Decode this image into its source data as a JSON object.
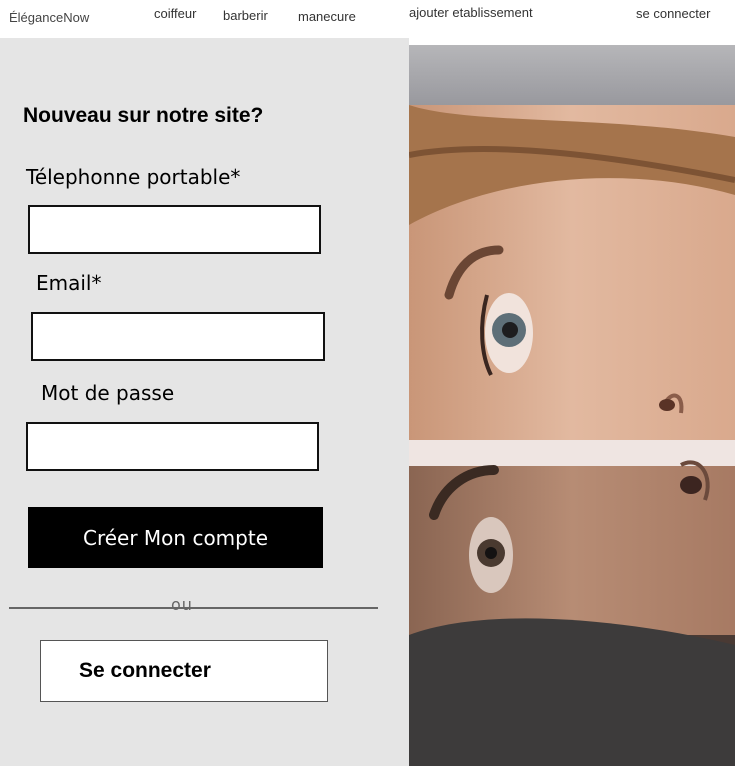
{
  "header": {
    "brand": "ÉléganceNow",
    "nav": {
      "coiffeur": "coiffeur",
      "barberir": "barberir",
      "manecure": "manecure",
      "ajouter": "ajouter etablissement",
      "login": "se connecter"
    }
  },
  "signup": {
    "heading": "Nouveau sur notre site?",
    "phone_label": "Télephonne portable*",
    "email_label": "Email*",
    "password_label": "Mot de passe",
    "phone_value": "",
    "email_value": "",
    "password_value": "",
    "create_button": "Créer Mon compte",
    "divider": "ou",
    "login_button": "Se connecter"
  },
  "colors": {
    "panel_bg": "#e5e5e5",
    "button_dark": "#000000",
    "skin": "#d4a88c"
  }
}
